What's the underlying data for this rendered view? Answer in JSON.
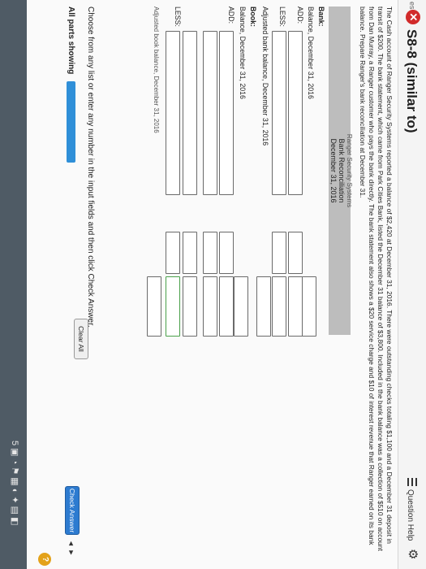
{
  "header": {
    "side_text": "es",
    "title": "S8-8 (similar to)",
    "question_help": "Question Help"
  },
  "problem_text": "The Cash account of Ranger Security Systems reported a balance of $2,420 at December 31, 2016. There were outstanding checks totaling $1,100 and a December 31 deposit in transit of $200. The bank statement, which came from Park Cities Bank, listed the December 31 balance of $3,800. Included in the bank balance was a collection of $510 on account from Dan Murray, a Ranger customer who pays the bank directly. The bank statement also shows a $20 service charge and $10 of interest revenue that Ranger earned on its bank balance. Prepare Ranger's bank reconciliation at December 31.",
  "panel": {
    "company": "Ranger Security Systems",
    "heading": "Bank Reconciliation",
    "date": "December 31, 2016"
  },
  "rows": {
    "bank": "Bank:",
    "bank_balance": "Balance, December 31, 2016",
    "add": "ADD:",
    "less": "LESS:",
    "adjusted_bank": "Adjusted bank balance, December 31, 2016",
    "book": "Book:",
    "book_balance": "Balance, December 31, 2016",
    "add2": "ADD:",
    "less2": "LESS:",
    "adjusted_book": "Adjusted book balance, December 31, 2016"
  },
  "footer": {
    "instruction": "Choose from any list or enter any number in the input fields and then click Check Answer.",
    "all_parts": "All parts showing",
    "clear_all": "Clear All",
    "check_answer": "Check Answer",
    "prev_arrow": "◄",
    "next_arrow": "►",
    "help_glyph": "?"
  },
  "taskbar": {
    "tray_text": "5 ▣ ◔ ⚑ ▦ ◐ ✦ ▤ ◧"
  },
  "colors": {
    "accent_blue": "#2d7bd0",
    "progress_blue": "#2f8fd8",
    "error_red": "#d12a2a",
    "input_green": "#49a04a",
    "panel_gray": "#bdbdbd"
  }
}
